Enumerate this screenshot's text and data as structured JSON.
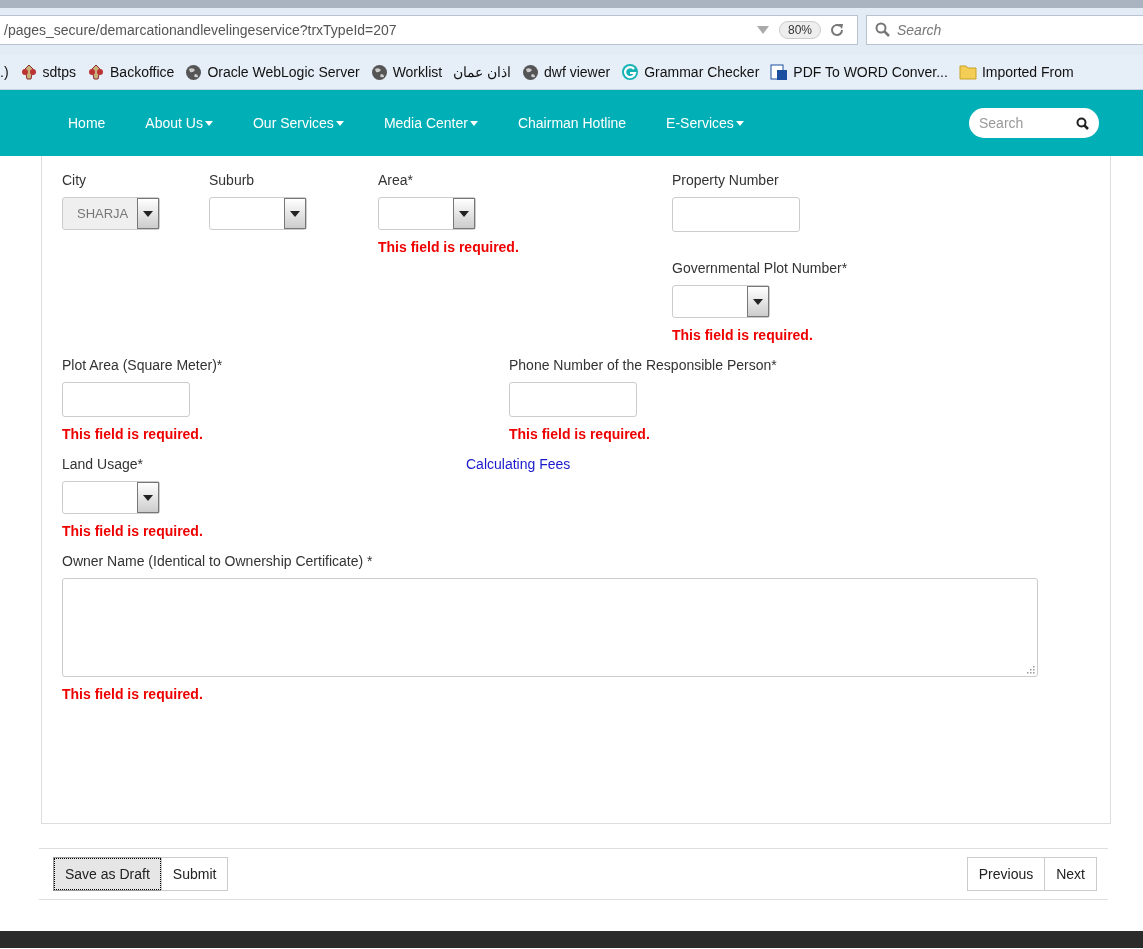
{
  "browser": {
    "url": "/pages_secure/demarcationandlevelingeservice?trxTypeId=207",
    "zoom": "80%",
    "search_placeholder": "Search",
    "bookmarks": [
      {
        "label": ".)",
        "kind": "none"
      },
      {
        "label": "sdtps",
        "kind": "emblem"
      },
      {
        "label": "Backoffice",
        "kind": "emblem"
      },
      {
        "label": "Oracle WebLogic Server",
        "kind": "globe"
      },
      {
        "label": "Worklist",
        "kind": "globe"
      },
      {
        "label": "اذان عمان",
        "kind": "none"
      },
      {
        "label": "dwf viewer",
        "kind": "globe"
      },
      {
        "label": "Grammar Checker",
        "kind": "grammar"
      },
      {
        "label": "PDF To WORD Conver...",
        "kind": "pdf"
      },
      {
        "label": "Imported From",
        "kind": "folder"
      }
    ]
  },
  "nav": {
    "items": [
      {
        "label": "Home",
        "dropdown": false
      },
      {
        "label": "About Us",
        "dropdown": true
      },
      {
        "label": "Our Services",
        "dropdown": true
      },
      {
        "label": "Media Center",
        "dropdown": true
      },
      {
        "label": "Chairman Hotline",
        "dropdown": false
      },
      {
        "label": "E-Services",
        "dropdown": true
      }
    ],
    "search_placeholder": "Search"
  },
  "form": {
    "rows": [
      {
        "fields": [
          {
            "kind": "select",
            "label": "City",
            "value": "SHARJA",
            "disabled": true
          },
          {
            "kind": "select",
            "label": "Suburb",
            "disabled": false
          },
          {
            "kind": "select",
            "label": "Area*",
            "disabled": false,
            "error": "This field is required."
          },
          {
            "kind": "stack",
            "fields": [
              {
                "kind": "text",
                "label": "Property Number"
              },
              {
                "kind": "select",
                "label": "Governmental Plot Number*",
                "disabled": false,
                "error": "This field is required."
              }
            ]
          }
        ]
      },
      {
        "fields": [
          {
            "kind": "text",
            "label": "Plot Area (Square Meter)*",
            "error": "This field is required."
          },
          {
            "kind": "text",
            "label": "Phone Number of the Responsible Person*",
            "error": "This field is required."
          }
        ]
      },
      {
        "fields": [
          {
            "kind": "select",
            "label": "Land Usage*",
            "disabled": false,
            "error": "This field is required."
          },
          {
            "kind": "link",
            "label": "Calculating Fees"
          }
        ]
      },
      {
        "fields": [
          {
            "kind": "textarea",
            "label": "Owner Name (Identical to Ownership Certificate) *",
            "error": "This field is required."
          }
        ]
      }
    ]
  },
  "footer": {
    "left_buttons": [
      {
        "label": "Save as Draft",
        "focused": true
      },
      {
        "label": "Submit",
        "focused": false
      }
    ],
    "right_buttons": [
      {
        "label": "Previous",
        "focused": false
      },
      {
        "label": "Next",
        "focused": false
      }
    ]
  }
}
